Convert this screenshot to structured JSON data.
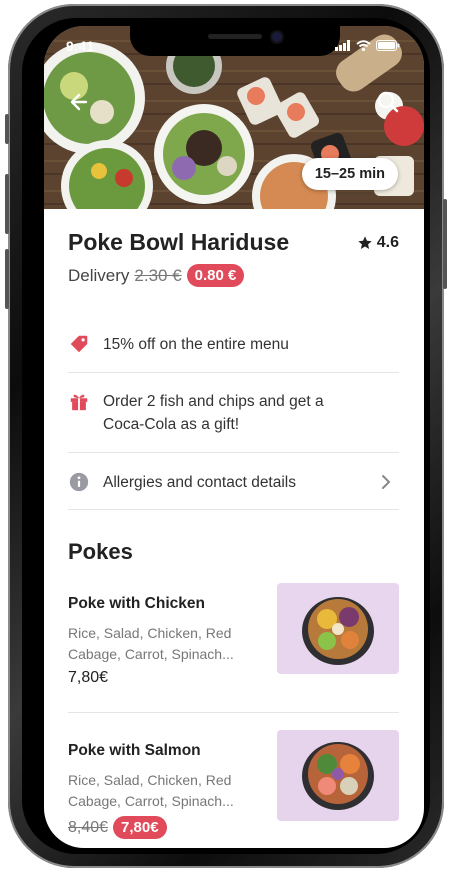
{
  "status": {
    "time": "9:41"
  },
  "restaurant": {
    "eta": "15–25 min",
    "name": "Poke Bowl Hariduse",
    "rating": "4.6",
    "delivery_label": "Delivery",
    "delivery_old_price": "2.30 €",
    "delivery_new_price": "0.80 €"
  },
  "offers": [
    {
      "icon": "tag-icon",
      "text": "15% off on the entire menu"
    },
    {
      "icon": "gift-icon",
      "line1": "Order 2 fish and chips and get a",
      "line2": "Coca-Cola as a gift!"
    }
  ],
  "allergies": {
    "icon": "info-icon",
    "text": "Allergies and contact details"
  },
  "menu": {
    "section_title": "Pokes",
    "items": [
      {
        "name": "Poke with Chicken",
        "desc_line1": "Rice, Salad, Chicken, Red",
        "desc_line2": "Cabage, Carrot, Spinach...",
        "price": "7,80€"
      },
      {
        "name": "Poke with Salmon",
        "desc_line1": "Rice, Salad, Chicken, Red",
        "desc_line2": "Cabage, Carrot, Spinach...",
        "old_price": "8,40€",
        "price": "7,80€"
      }
    ]
  },
  "colors": {
    "accent": "#e04a5a",
    "text": "#222222",
    "muted": "#777777"
  }
}
